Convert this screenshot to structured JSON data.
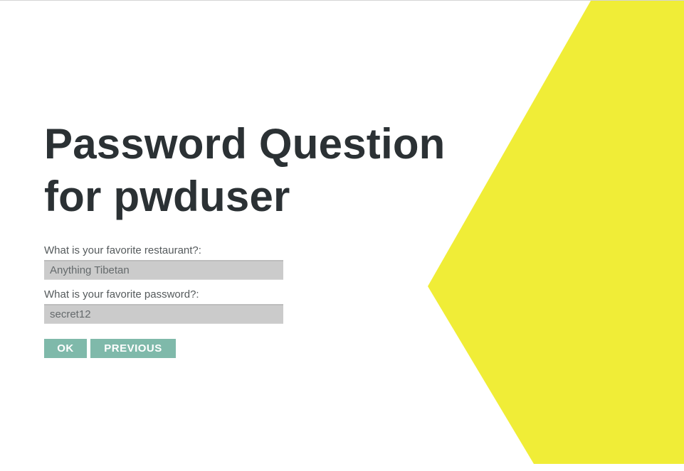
{
  "title": {
    "line1": "Password Question",
    "line2": "for pwduser"
  },
  "form": {
    "question1": {
      "label": "What is your favorite restaurant?:",
      "value": "Anything Tibetan"
    },
    "question2": {
      "label": "What is your favorite password?:",
      "value": "secret12"
    }
  },
  "buttons": {
    "ok_label": "OK",
    "previous_label": "PREVIOUS"
  },
  "colors": {
    "accent_shape": "#f0ed37",
    "button": "#7fb9aa",
    "title_text": "#2b3134",
    "input_bg": "#cbcbcb"
  }
}
